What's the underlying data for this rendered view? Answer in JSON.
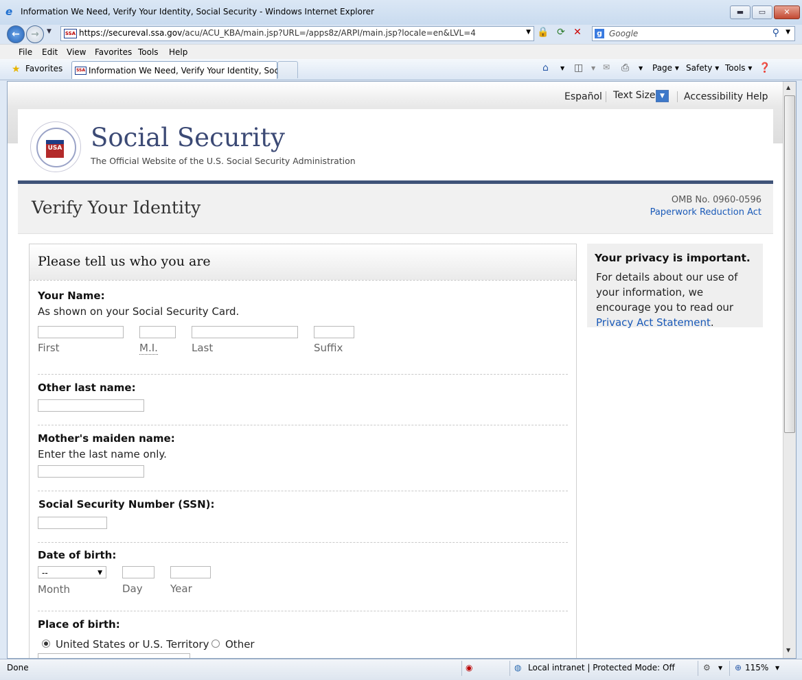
{
  "window": {
    "title": "Information We Need, Verify Your Identity, Social Security - Windows Internet Explorer",
    "minimize": "▬",
    "maximize": "▭",
    "close": "✕"
  },
  "navbar": {
    "url_host": "https://secureval.ssa.gov",
    "url_path": "/acu/ACU_KBA/main.jsp?URL=/apps8z/ARPI/main.jsp?locale=en&LVL=4",
    "search_placeholder": "Google",
    "favicon_text": "SSA"
  },
  "menu": [
    "File",
    "Edit",
    "View",
    "Favorites",
    "Tools",
    "Help"
  ],
  "favbar": {
    "favorites_label": "Favorites",
    "tab_title": "Information We Need, Verify Your Identity, Social...",
    "commands": {
      "page": "Page ▾",
      "safety": "Safety ▾",
      "tools": "Tools ▾"
    }
  },
  "utility": {
    "espanol": "Español",
    "text_size": "Text Size",
    "accessibility": "Accessibility Help"
  },
  "header": {
    "brand": "Social Security",
    "tagline": "The Official Website of the U.S. Social Security Administration",
    "logo_text": "USA"
  },
  "titleband": {
    "title": "Verify Your Identity",
    "omb": "OMB No. 0960-0596",
    "paperwork_link": "Paperwork Reduction Act"
  },
  "form": {
    "heading": "Please tell us who you are",
    "name": {
      "label": "Your Name:",
      "hint": "As shown on your Social Security Card.",
      "first": "First",
      "mi": "M.I.",
      "last": "Last",
      "suffix": "Suffix"
    },
    "other_last_name": {
      "label": "Other last name:"
    },
    "maiden": {
      "label": "Mother's maiden name:",
      "hint": "Enter the last name only."
    },
    "ssn": {
      "label": "Social Security Number (SSN):"
    },
    "dob": {
      "label": "Date of birth:",
      "month_value": "--",
      "month": "Month",
      "day": "Day",
      "year": "Year"
    },
    "pob": {
      "label": "Place of birth:",
      "option_us": "United States or U.S. Territory",
      "option_other": "Other",
      "selected": "United States or U.S. Territory"
    }
  },
  "privacy": {
    "heading": "Your privacy is important.",
    "body": "For details about our use of your information, we encourage you to read our ",
    "link": "Privacy Act Statement",
    "after": "."
  },
  "statusbar": {
    "status": "Done",
    "zone": "Local intranet | Protected Mode: Off",
    "zoom": "115%"
  }
}
